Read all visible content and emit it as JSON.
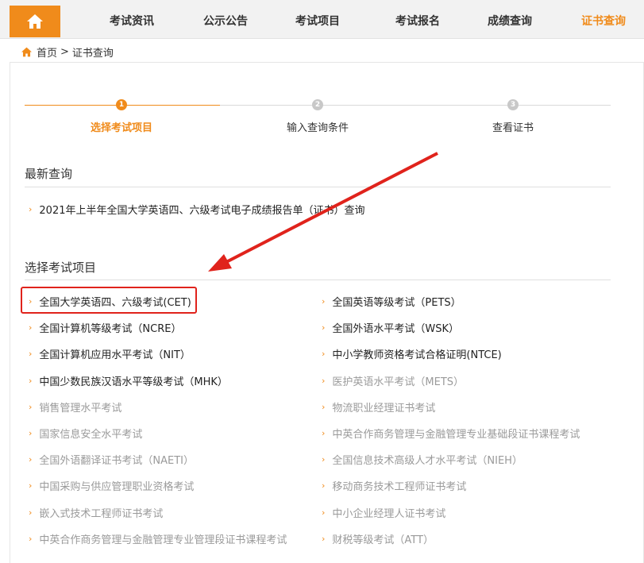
{
  "nav": {
    "home_icon": "home-icon",
    "items": [
      "考试资讯",
      "公示公告",
      "考试项目",
      "考试报名",
      "成绩查询",
      "证书查询"
    ],
    "active_index": 5,
    "accent": "#f08b1b"
  },
  "breadcrumb": {
    "home": "首页",
    "separator": ">",
    "current": "证书查询"
  },
  "steps": [
    {
      "num": "1",
      "label": "选择考试项目",
      "active": true
    },
    {
      "num": "2",
      "label": "输入查询条件",
      "active": false
    },
    {
      "num": "3",
      "label": "查看证书",
      "active": false
    }
  ],
  "latest": {
    "title": "最新查询",
    "items": [
      "2021年上半年全国大学英语四、六级考试电子成绩报告单（证书）查询"
    ]
  },
  "projects": {
    "title": "选择考试项目",
    "left": [
      {
        "label": "全国大学英语四、六级考试(CET)",
        "enabled": true,
        "highlighted": true
      },
      {
        "label": "全国计算机等级考试（NCRE）",
        "enabled": true
      },
      {
        "label": "全国计算机应用水平考试（NIT）",
        "enabled": true
      },
      {
        "label": "中国少数民族汉语水平等级考试（MHK）",
        "enabled": true
      },
      {
        "label": "销售管理水平考试",
        "enabled": false
      },
      {
        "label": "国家信息安全水平考试",
        "enabled": false
      },
      {
        "label": "全国外语翻译证书考试（NAETI）",
        "enabled": false
      },
      {
        "label": "中国采购与供应管理职业资格考试",
        "enabled": false
      },
      {
        "label": "嵌入式技术工程师证书考试",
        "enabled": false
      },
      {
        "label": "中英合作商务管理与金融管理专业管理段证书课程考试",
        "enabled": false
      }
    ],
    "right": [
      {
        "label": "全国英语等级考试（PETS）",
        "enabled": true
      },
      {
        "label": "全国外语水平考试（WSK）",
        "enabled": true
      },
      {
        "label": "中小学教师资格考试合格证明(NTCE)",
        "enabled": true
      },
      {
        "label": "医护英语水平考试（METS）",
        "enabled": false
      },
      {
        "label": "物流职业经理证书考试",
        "enabled": false
      },
      {
        "label": "中英合作商务管理与金融管理专业基础段证书课程考试",
        "enabled": false
      },
      {
        "label": "全国信息技术高级人才水平考试（NIEH）",
        "enabled": false
      },
      {
        "label": "移动商务技术工程师证书考试",
        "enabled": false
      },
      {
        "label": "中小企业经理人证书考试",
        "enabled": false
      },
      {
        "label": "财税等级考试（ATT）",
        "enabled": false
      }
    ]
  },
  "annotation": {
    "arrow_color": "#e0231c"
  }
}
